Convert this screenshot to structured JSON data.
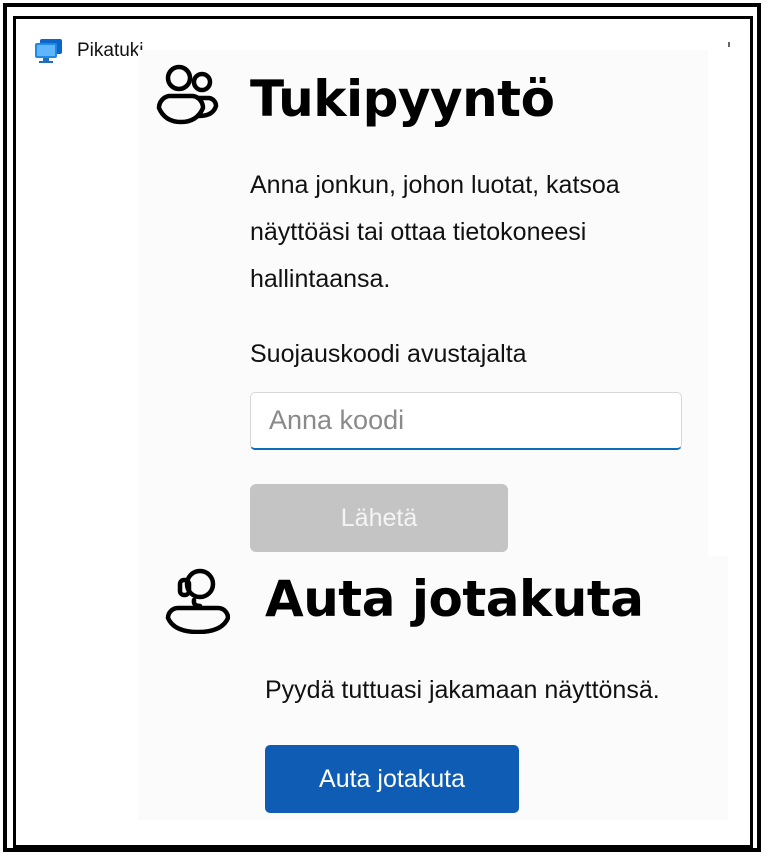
{
  "window": {
    "title": "Pikatuki",
    "icon": "remote-desktop-monitor-icon"
  },
  "request_section": {
    "icon": "people-group-icon",
    "heading": "Tukipyyntö",
    "description": "Anna jonkun, johon luotat, katsoa näyttöäsi tai ottaa tietokoneesi hallintaansa.",
    "code_label": "Suojauskoodi avustajalta",
    "code_input": {
      "value": "",
      "placeholder": "Anna koodi"
    },
    "send_label": "Lähetä",
    "send_enabled": false
  },
  "help_section": {
    "icon": "person-headset-icon",
    "heading": "Auta jotakuta",
    "description": "Pyydä tuttuasi jakamaan näyttönsä.",
    "button_label": "Auta jotakuta"
  },
  "colors": {
    "accent": "#0f5cb5",
    "input_focus_underline": "#0f6cbd",
    "disabled_button": "#c4c4c4",
    "panel_background": "#fbfbfb"
  }
}
